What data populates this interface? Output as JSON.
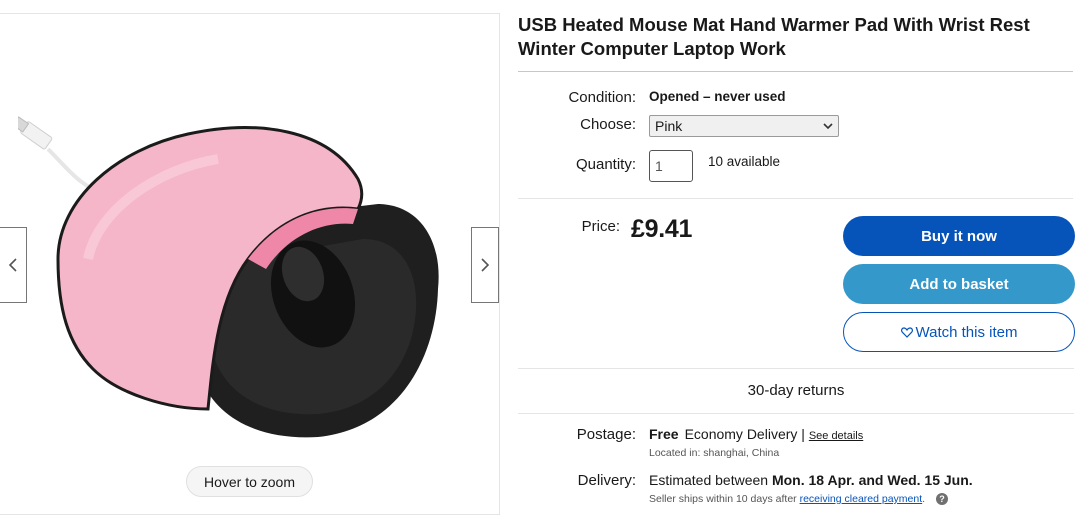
{
  "gallery": {
    "zoom_label": "Hover to zoom",
    "image_alt": "USB heated mouse mat hand warmer pad, pink plush",
    "colors": {
      "plush": "#f4b6c8",
      "plush_dark": "#e79ab2",
      "pad": "#222222",
      "inner": "#ef87a8"
    }
  },
  "listing": {
    "title": "USB Heated Mouse Mat Hand Warmer Pad With Wrist Rest Winter Computer Laptop Work",
    "condition_label": "Condition:",
    "condition_value": "Opened – never used",
    "choose_label": "Choose:",
    "choose_value": "Pink",
    "quantity_label": "Quantity:",
    "quantity_value": "1",
    "available": "10 available",
    "price_label": "Price:",
    "price": "£9.41"
  },
  "actions": {
    "buy_now": "Buy it now",
    "add_to_basket": "Add to basket",
    "watch": "Watch this item",
    "colors": {
      "primary": "#0654ba",
      "secondary": "#3498ca"
    }
  },
  "returns": "30-day returns",
  "shipping": {
    "postage_label": "Postage:",
    "postage_free": "Free",
    "postage_service": "Economy Delivery |",
    "see_details": "See details",
    "located_in": "Located in:  shanghai, China",
    "delivery_label": "Delivery:",
    "delivery_prefix": "Estimated between",
    "delivery_dates": "Mon. 18 Apr. and Wed. 15 Jun.",
    "dispatch_prefix": "Seller ships within 10 days after",
    "dispatch_link": "receiving cleared payment",
    "dispatch_suffix": "."
  }
}
